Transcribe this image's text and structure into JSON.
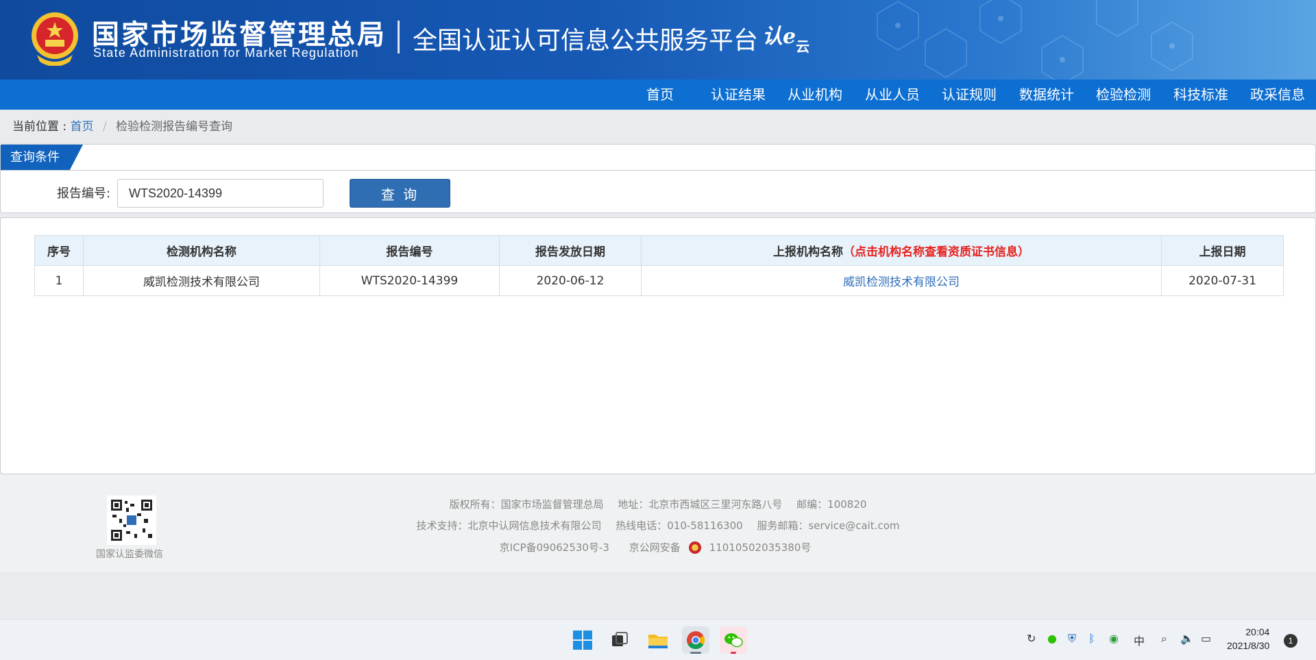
{
  "header": {
    "agency_cn": "国家市场监督管理总局",
    "agency_en": "State Administration for Market Regulation",
    "platform": "全国认证认可信息公共服务平台",
    "brand_main": "认e",
    "brand_sub": "云"
  },
  "nav": {
    "items": [
      {
        "label": "首页"
      },
      {
        "label": "认证结果"
      },
      {
        "label": "从业机构"
      },
      {
        "label": "从业人员"
      },
      {
        "label": "认证规则"
      },
      {
        "label": "数据统计"
      },
      {
        "label": "检验检测"
      },
      {
        "label": "科技标准"
      },
      {
        "label": "政采信息"
      }
    ]
  },
  "breadcrumb": {
    "prefix": "当前位置 :",
    "home": "首页",
    "current": "检验检测报告编号查询"
  },
  "query": {
    "tab_label": "查询条件",
    "field_label": "报告编号:",
    "field_value": "WTS2020-14399",
    "button_label": "查 询"
  },
  "results": {
    "headers": {
      "seq": "序号",
      "org_name": "检测机构名称",
      "report_no": "报告编号",
      "issue_date": "报告发放日期",
      "reporter": "上报机构名称",
      "reporter_note": "（点击机构名称查看资质证书信息）",
      "report_date": "上报日期"
    },
    "rows": [
      {
        "seq": "1",
        "org_name": "威凯检测技术有限公司",
        "report_no": "WTS2020-14399",
        "issue_date": "2020-06-12",
        "reporter": "威凯检测技术有限公司",
        "report_date": "2020-07-31"
      }
    ]
  },
  "footer": {
    "qr_caption": "国家认监委微信",
    "line1": [
      "版权所有：国家市场监督管理总局",
      "地址：北京市西城区三里河东路八号",
      "邮编：100820"
    ],
    "line2": [
      "技术支持：北京中认网信息技术有限公司",
      "热线电话：010-58116300",
      "服务邮箱：service@cait.com"
    ],
    "icp": "京ICP备09062530号-3",
    "police_prefix": "京公网安备",
    "police_no": "11010502035380号"
  },
  "taskbar": {
    "ime": "中",
    "time": "20:04",
    "date": "2021/8/30",
    "notifications": "1"
  }
}
